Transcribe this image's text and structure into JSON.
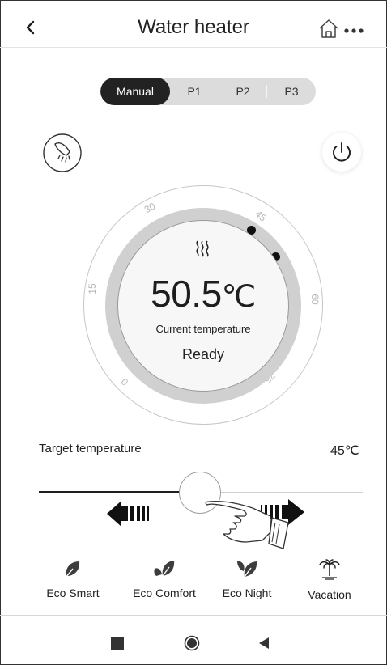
{
  "header": {
    "title": "Water heater",
    "back_icon": "back-chevron-icon",
    "home_icon": "home-icon",
    "more_icon": "more-icon"
  },
  "modes": {
    "tabs": [
      {
        "label": "Manual",
        "active": true
      },
      {
        "label": "P1",
        "active": false
      },
      {
        "label": "P2",
        "active": false
      },
      {
        "label": "P3",
        "active": false
      }
    ]
  },
  "controls": {
    "shower_icon": "shower-icon",
    "power_icon": "power-icon"
  },
  "dial": {
    "ticks": [
      "30",
      "45",
      "15",
      "60",
      "0",
      "75"
    ],
    "current_temperature": "50.5",
    "unit": "℃",
    "current_label": "Current temperature",
    "status": "Ready",
    "heat_icon": "heat-wave-icon"
  },
  "target": {
    "label": "Target temperature",
    "value": "45℃"
  },
  "eco_modes": [
    {
      "label": "Eco Smart",
      "icon": "leaf-icon"
    },
    {
      "label": "Eco Comfort",
      "icon": "leaf-pot-icon"
    },
    {
      "label": "Eco Night",
      "icon": "leaf-moon-icon"
    },
    {
      "label": "Vacation",
      "icon": "palm-tree-icon"
    }
  ],
  "navbar": {
    "recent_icon": "recent-apps-icon",
    "home_icon": "nav-home-icon",
    "back_icon": "nav-back-icon"
  },
  "colors": {
    "accent": "#222222",
    "track": "#1e1e1e",
    "ring": "#d0d0d0"
  }
}
